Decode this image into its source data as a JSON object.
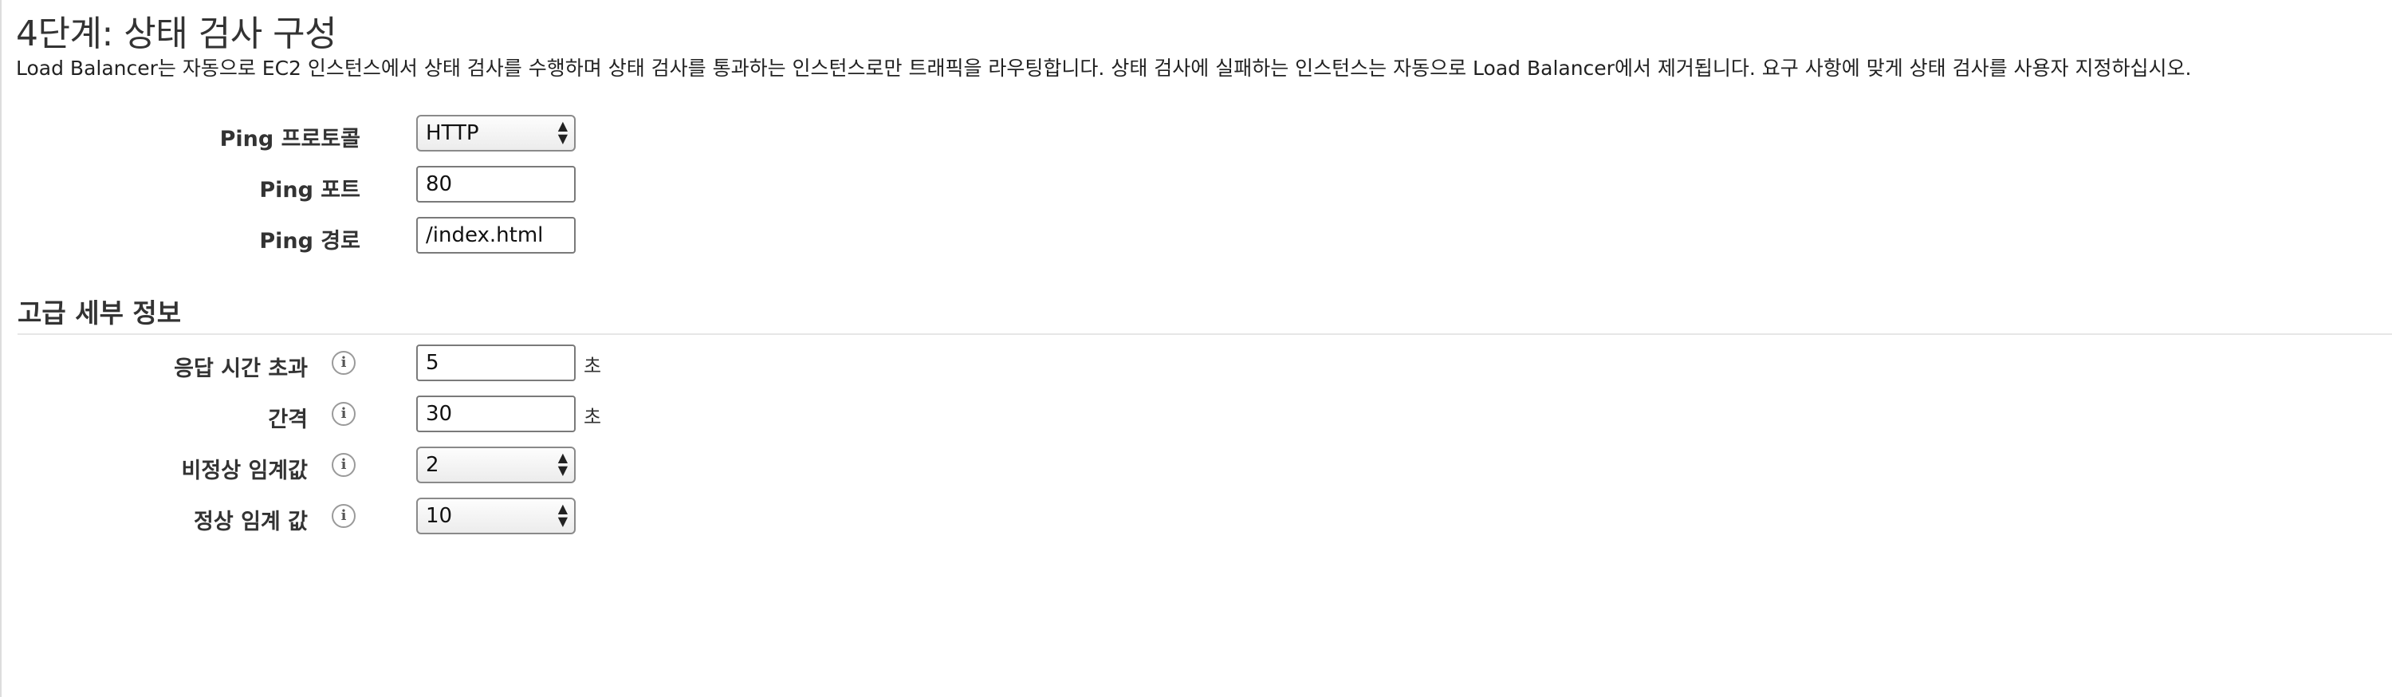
{
  "header": {
    "title": "4단계: 상태 검사 구성",
    "description": "Load Balancer는 자동으로 EC2 인스턴스에서 상태 검사를 수행하며 상태 검사를 통과하는 인스턴스로만 트래픽을 라우팅합니다. 상태 검사에 실패하는 인스턴스는 자동으로 Load Balancer에서 제거됩니다. 요구 사항에 맞게 상태 검사를 사용자 지정하십시오."
  },
  "basic": {
    "ping_protocol": {
      "label": "Ping 프로토콜",
      "value": "HTTP"
    },
    "ping_port": {
      "label": "Ping 포트",
      "value": "80"
    },
    "ping_path": {
      "label": "Ping 경로",
      "value": "/index.html"
    }
  },
  "advanced": {
    "title": "고급 세부 정보",
    "response_timeout": {
      "label": "응답 시간 초과",
      "value": "5",
      "unit": "초"
    },
    "interval": {
      "label": "간격",
      "value": "30",
      "unit": "초"
    },
    "unhealthy_threshold": {
      "label": "비정상 임계값",
      "value": "2"
    },
    "healthy_threshold": {
      "label": "정상 임계 값",
      "value": "10"
    },
    "info_icon_glyph": "i"
  },
  "icons": {
    "info": "info-icon",
    "select_arrows": "up-down-arrows-icon"
  }
}
